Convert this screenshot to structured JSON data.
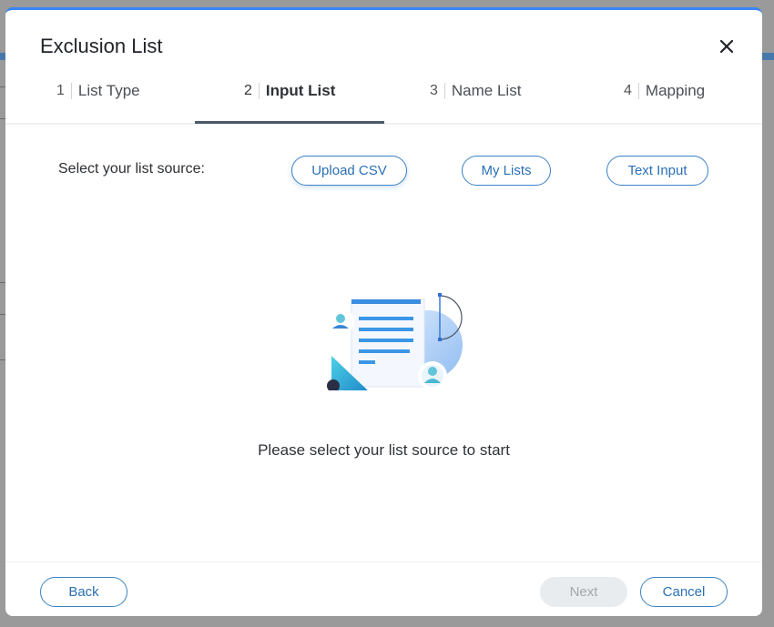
{
  "modal": {
    "title": "Exclusion List",
    "close_icon": "close-icon"
  },
  "steps": [
    {
      "num": "1",
      "label": "List Type",
      "active": false
    },
    {
      "num": "2",
      "label": "Input List",
      "active": true
    },
    {
      "num": "3",
      "label": "Name List",
      "active": false
    },
    {
      "num": "4",
      "label": "Mapping",
      "active": false
    }
  ],
  "source": {
    "label": "Select your list source:",
    "options": [
      "Upload CSV",
      "My Lists",
      "Text Input"
    ]
  },
  "empty_state": {
    "message": "Please select your list source to start",
    "illustration_icon": "list-document-illustration"
  },
  "footer": {
    "back": "Back",
    "next": "Next",
    "cancel": "Cancel"
  },
  "colors": {
    "accent": "#3b82c4",
    "active_step_underline": "#4a5a6a",
    "disabled_bg": "#e9ecef"
  }
}
